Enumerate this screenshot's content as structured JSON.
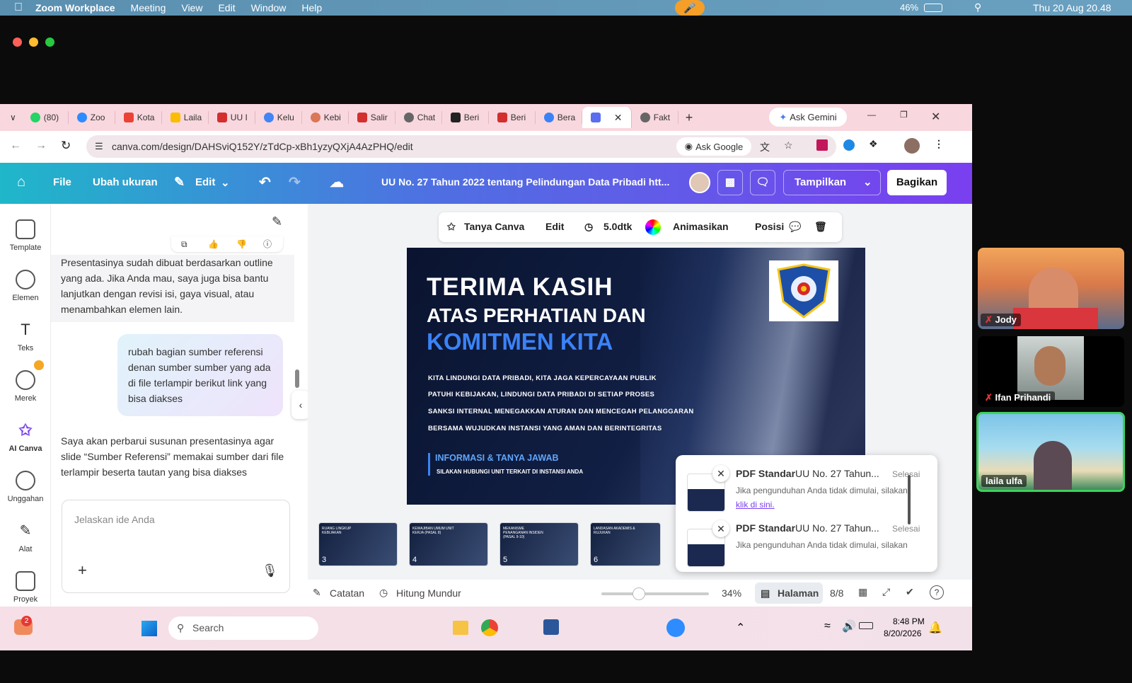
{
  "macbar": {
    "app_name": "Zoom Workplace",
    "menus": [
      "Meeting",
      "View",
      "Edit",
      "Window",
      "Help"
    ],
    "battery": "46%",
    "clock": "Thu 20 Aug  20.48"
  },
  "browser": {
    "tabs": [
      "(80)",
      "Zoo",
      "Kota",
      "Laila",
      "UU I",
      "Kelu",
      "Kebi",
      "Salir",
      "Chat",
      "Beri",
      "Beri",
      "Bera",
      "",
      "Fakt"
    ],
    "ask_gemini": "Ask Gemini",
    "url": "canva.com/design/DAHSviQ152Y/zTdCp-xBh1yzyQXjA4AzPHQ/edit",
    "ask_google": "Ask Google"
  },
  "canva_header": {
    "file": "File",
    "resize": "Ubah ukuran",
    "edit": "Edit",
    "doc_title": "UU No. 27 Tahun 2022 tentang Pelindungan Data Pribadi htt...",
    "present": "Tampilkan",
    "share": "Bagikan"
  },
  "left_nav": [
    "Template",
    "Elemen",
    "Teks",
    "Merek",
    "AI Canva",
    "Unggahan",
    "Alat",
    "Proyek"
  ],
  "chat": {
    "assistant_msg_1": "Presentasinya sudah dibuat berdasarkan outline yang ada. Jika Anda mau, saya juga bisa bantu lanjutkan dengan revisi isi, gaya visual, atau menambahkan elemen lain.",
    "user_msg": "rubah bagian sumber referensi denan sumber sumber yang ada di file terlampir berikut link yang bisa diakses",
    "assistant_msg_2": "Saya akan perbarui susunan presentasinya agar slide “Sumber Referensi” memakai sumber dari file terlampir beserta tautan yang bisa diakses",
    "input_placeholder": "Jelaskan ide Anda"
  },
  "canvas_toolbar": {
    "ask_canva": "Tanya Canva",
    "edit": "Edit",
    "duration": "5.0dtk",
    "animate": "Animasikan",
    "position": "Posisi"
  },
  "slide": {
    "title1": "TERIMA KASIH",
    "title2": "ATAS PERHATIAN DAN",
    "title3": "KOMITMEN KITA",
    "bullets": [
      "KITA LINDUNGI DATA PRIBADI, KITA JAGA KEPERCAYAAN PUBLIK",
      "PATUHI KEBIJAKAN, LINDUNGI DATA PRIBADI DI SETIAP PROSES",
      "SANKSI INTERNAL MENEGAKKAN ATURAN DAN MENCEGAH PELANGGARAN",
      "BERSAMA WUJUDKAN INSTANSI YANG AMAN DAN BERINTEGRITAS"
    ],
    "info_title": "INFORMASI & TANYA JAWAB",
    "info_sub": "SILAKAN HUBUNGI UNIT TERKAIT DI INSTANSI ANDA",
    "logo_text": "UNIVERSITAS RESPATI INDONESIA URINDO"
  },
  "thumbnails": [
    {
      "num": "3",
      "label": "RUANG LINGKUP KEBIJAKAN"
    },
    {
      "num": "4",
      "label": "KEWAJIBAN UMUM UNIT KERJA (PASAL 8)"
    },
    {
      "num": "5",
      "label": "MEKANISME PENANGANAN INSIDEN (PASAL 9-10)"
    },
    {
      "num": "6",
      "label": "LANDASAN AKADEMIS & RUJUKAN"
    }
  ],
  "downloads": [
    {
      "title": "PDF Standar",
      "file": "UU No. 27 Tahun...",
      "status": "Selesai",
      "msg": "Jika pengunduhan Anda tidak dimulai, silakan",
      "link": "klik di sini."
    },
    {
      "title": "PDF Standar",
      "file": "UU No. 27 Tahun...",
      "status": "Selesai",
      "msg": "Jika pengunduhan Anda tidak dimulai, silakan",
      "link": ""
    }
  ],
  "bottom_bar": {
    "notes": "Catatan",
    "timer": "Hitung Mundur",
    "zoom": "34%",
    "pages": "Halaman",
    "page_count": "8/8"
  },
  "taskbar": {
    "search": "Search",
    "notif_count": "2",
    "time": "8:48 PM",
    "date": "8/20/2026"
  },
  "participants": [
    "Jody",
    "Ifan Prihandi",
    "laila ulfa"
  ],
  "colors": {
    "canva_gradient_start": "#1fb7c9",
    "canva_gradient_end": "#7a3ff0",
    "accent_blue": "#3b82f6",
    "active_speaker": "#3cd35c"
  }
}
